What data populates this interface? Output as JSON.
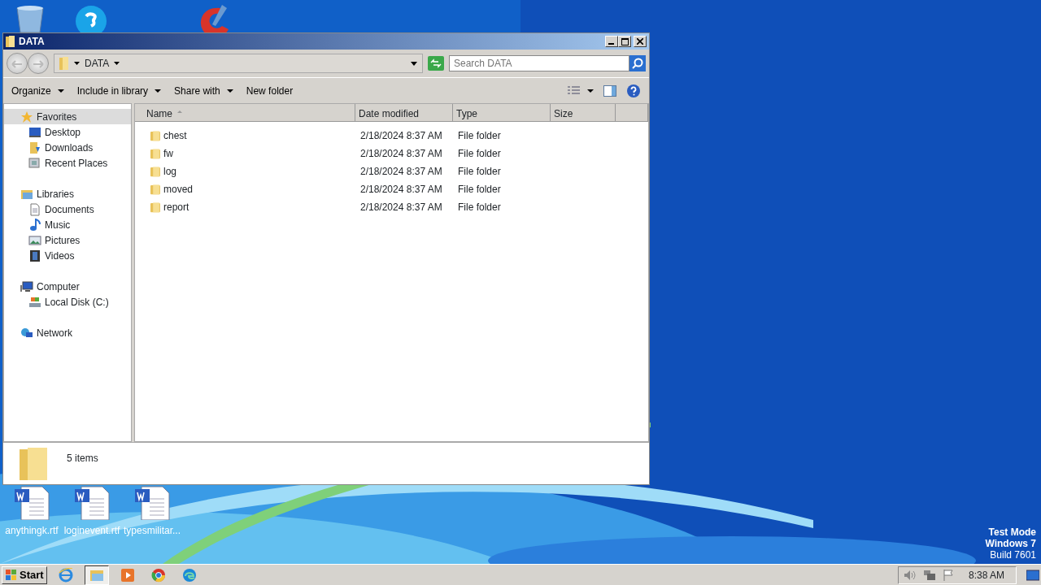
{
  "window": {
    "title": "DATA",
    "breadcrumb": "DATA",
    "search": {
      "placeholder": "Search DATA"
    }
  },
  "toolbar": [
    {
      "label": "Organize",
      "dropdown": true
    },
    {
      "label": "Include in library",
      "dropdown": true
    },
    {
      "label": "Share with",
      "dropdown": true
    },
    {
      "label": "New folder",
      "dropdown": false
    }
  ],
  "sidebar": [
    {
      "label": "Favorites",
      "kind": "star",
      "selected": true,
      "children": [
        {
          "label": "Desktop",
          "kind": "desktop",
          "selected": false
        },
        {
          "label": "Downloads",
          "kind": "downloads",
          "selected": false
        },
        {
          "label": "Recent Places",
          "kind": "recent",
          "selected": false
        }
      ]
    },
    {
      "label": "Libraries",
      "kind": "library",
      "selected": false,
      "children": [
        {
          "label": "Documents",
          "kind": "document",
          "selected": false
        },
        {
          "label": "Music",
          "kind": "music",
          "selected": false
        },
        {
          "label": "Pictures",
          "kind": "picture",
          "selected": false
        },
        {
          "label": "Videos",
          "kind": "video",
          "selected": false
        }
      ]
    },
    {
      "label": "Computer",
      "kind": "computer",
      "selected": false,
      "children": [
        {
          "label": "Local Disk (C:)",
          "kind": "disk",
          "selected": false
        }
      ]
    },
    {
      "label": "Network",
      "kind": "network",
      "selected": false
    }
  ],
  "columns": [
    {
      "label": "Name",
      "sorted": true
    },
    {
      "label": "Date modified",
      "sorted": false
    },
    {
      "label": "Type",
      "sorted": false
    },
    {
      "label": "Size",
      "sorted": false
    }
  ],
  "rows": [
    {
      "name": "chest",
      "date_modified": "2/18/2024 8:37 AM",
      "type": "File folder"
    },
    {
      "name": "fw",
      "date_modified": "2/18/2024 8:37 AM",
      "type": "File folder"
    },
    {
      "name": "log",
      "date_modified": "2/18/2024 8:37 AM",
      "type": "File folder"
    },
    {
      "name": "moved",
      "date_modified": "2/18/2024 8:37 AM",
      "type": "File folder"
    },
    {
      "name": "report",
      "date_modified": "2/18/2024 8:37 AM",
      "type": "File folder"
    }
  ],
  "details": {
    "count": "5 items"
  },
  "desktop_icons": [
    {
      "label": "anythingk.rtf"
    },
    {
      "label": "loginevent.rtf"
    },
    {
      "label": "typesmilitar..."
    }
  ],
  "desktop_notice": [
    "Test Mode",
    "Windows 7",
    "Build 7601"
  ],
  "taskbar": {
    "start": "Start",
    "apps": [
      {
        "kind": "browser-e",
        "selected": false
      },
      {
        "kind": "explorer",
        "selected": true
      },
      {
        "kind": "player",
        "selected": false
      },
      {
        "kind": "chrome",
        "selected": false
      },
      {
        "kind": "edge",
        "selected": false
      }
    ],
    "clock": "8:38 AM"
  }
}
